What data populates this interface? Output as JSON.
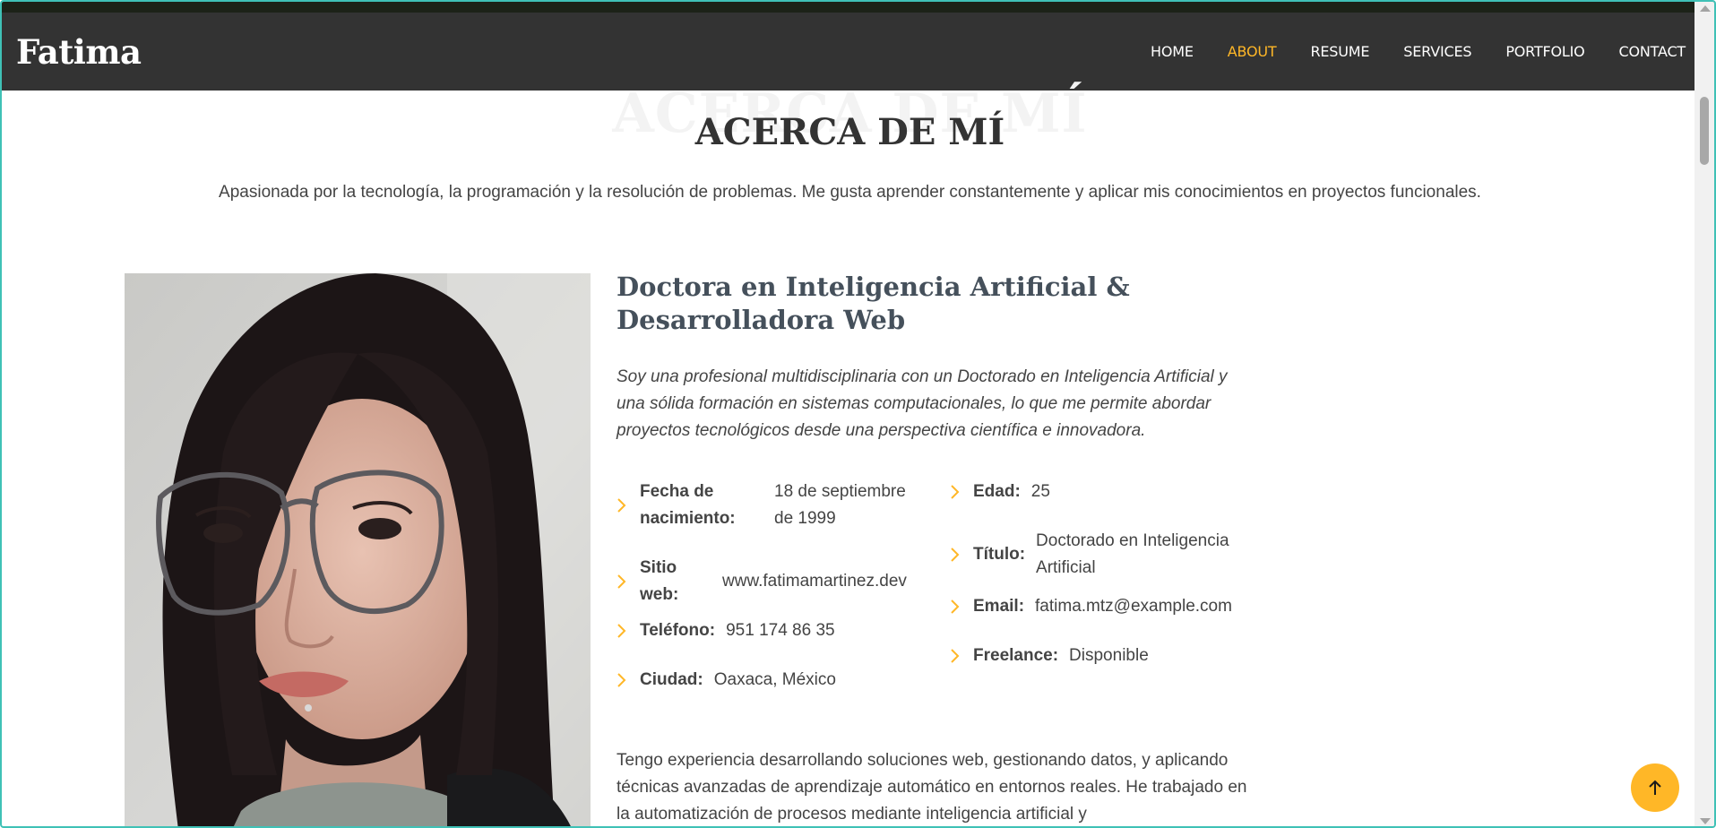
{
  "header": {
    "logo": "Fatima",
    "nav": [
      {
        "label": "HOME",
        "active": false
      },
      {
        "label": "ABOUT",
        "active": true
      },
      {
        "label": "RESUME",
        "active": false
      },
      {
        "label": "SERVICES",
        "active": false
      },
      {
        "label": "PORTFOLIO",
        "active": false
      },
      {
        "label": "CONTACT",
        "active": false
      }
    ]
  },
  "about": {
    "background_title": "ACERCA DE MÍ",
    "title": "ACERCA DE MÍ",
    "subtitle": "Apasionada por la tecnología, la programación y la resolución de problemas. Me gusta aprender constantemente y aplicar mis conocimientos en proyectos funcionales.",
    "role_line1": "Doctora en Inteligencia Artificial &",
    "role_line2": "Desarrolladora Web",
    "intro": "Soy una profesional multidisciplinaria con un Doctorado en Inteligencia Artificial y una sólida formación en sistemas computacionales, lo que me permite abordar proyectos tecnológicos desde una perspectiva científica e innovadora.",
    "info_left": [
      {
        "label": "Fecha de nacimiento:",
        "value": "18 de septiembre de 1999"
      },
      {
        "label": "Sitio web:",
        "value": "www.fatimamartinez.dev"
      },
      {
        "label": "Teléfono:",
        "value": "951 174 86 35"
      },
      {
        "label": "Ciudad:",
        "value": "Oaxaca, México"
      }
    ],
    "info_right": [
      {
        "label": "Edad:",
        "value": "25"
      },
      {
        "label": "Título:",
        "value": "Doctorado en Inteligencia Artificial"
      },
      {
        "label": "Email:",
        "value": "fatima.mtz@example.com"
      },
      {
        "label": "Freelance:",
        "value": "Disponible"
      }
    ],
    "outro": "Tengo experiencia desarrollando soluciones web, gestionando datos, y aplicando técnicas avanzadas de aprendizaje automático en entornos reales. He trabajado en la automatización de procesos mediante inteligencia artificial y"
  },
  "colors": {
    "accent": "#ffb727",
    "header_bg": "#333333",
    "heading": "#45505b"
  },
  "icons": {
    "bullet": "chevron-right-icon",
    "back_to_top": "arrow-up-icon"
  }
}
